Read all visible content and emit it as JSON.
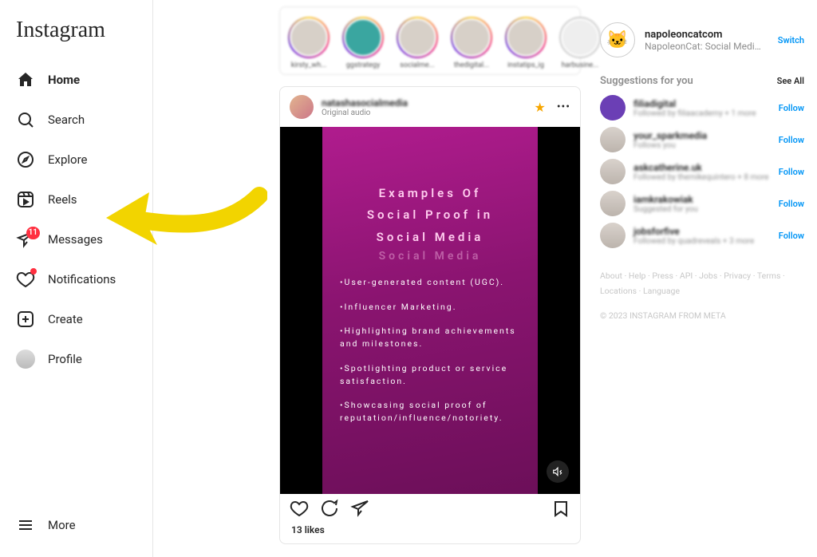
{
  "logo": "Instagram",
  "nav": {
    "home": "Home",
    "search": "Search",
    "explore": "Explore",
    "reels": "Reels",
    "messages": "Messages",
    "messages_badge": "11",
    "notifications": "Notifications",
    "create": "Create",
    "profile": "Profile",
    "more": "More"
  },
  "stories": [
    {
      "name": "kirsty_wh..."
    },
    {
      "name": "ggstrategy"
    },
    {
      "name": "socialme..."
    },
    {
      "name": "thedigital..."
    },
    {
      "name": "instatips_ig"
    },
    {
      "name": "harbusine..."
    }
  ],
  "post": {
    "user": "natashasocialmedia",
    "sub": "Original audio",
    "reel": {
      "title_1": "Examples Of",
      "title_2": "Social Proof in",
      "title_3": "Social Media",
      "title_shadow": "Social Media",
      "items": [
        "•User-generated content (UGC).",
        "•Influencer Marketing.",
        "•Highlighting brand achievements and milestones.",
        "•Spotlighting product or service satisfaction.",
        "•Showcasing social proof of reputation/influence/notoriety."
      ]
    },
    "likes": "13 likes"
  },
  "me": {
    "username": "napoleoncatcom",
    "sub": "NapoleonCat: Social Media …",
    "switch": "Switch"
  },
  "suggestions_header": "Suggestions for you",
  "see_all": "See All",
  "follow_label": "Follow",
  "suggestions": [
    {
      "name": "filiadigital",
      "sub": "Followed by filiaacademy + 1 more"
    },
    {
      "name": "your_sparkmedia",
      "sub": "Follows you"
    },
    {
      "name": "askcatherine.uk",
      "sub": "Followed by themikequintero + 8 more"
    },
    {
      "name": "iamkrakowiak",
      "sub": "Suggested for you"
    },
    {
      "name": "jobsforfive",
      "sub": "Followed by quadreveals + 3 more"
    }
  ],
  "footer": {
    "links": [
      "About",
      "Help",
      "Press",
      "API",
      "Jobs",
      "Privacy",
      "Terms",
      "Locations",
      "Language"
    ],
    "copyright": "© 2023 INSTAGRAM FROM META"
  }
}
